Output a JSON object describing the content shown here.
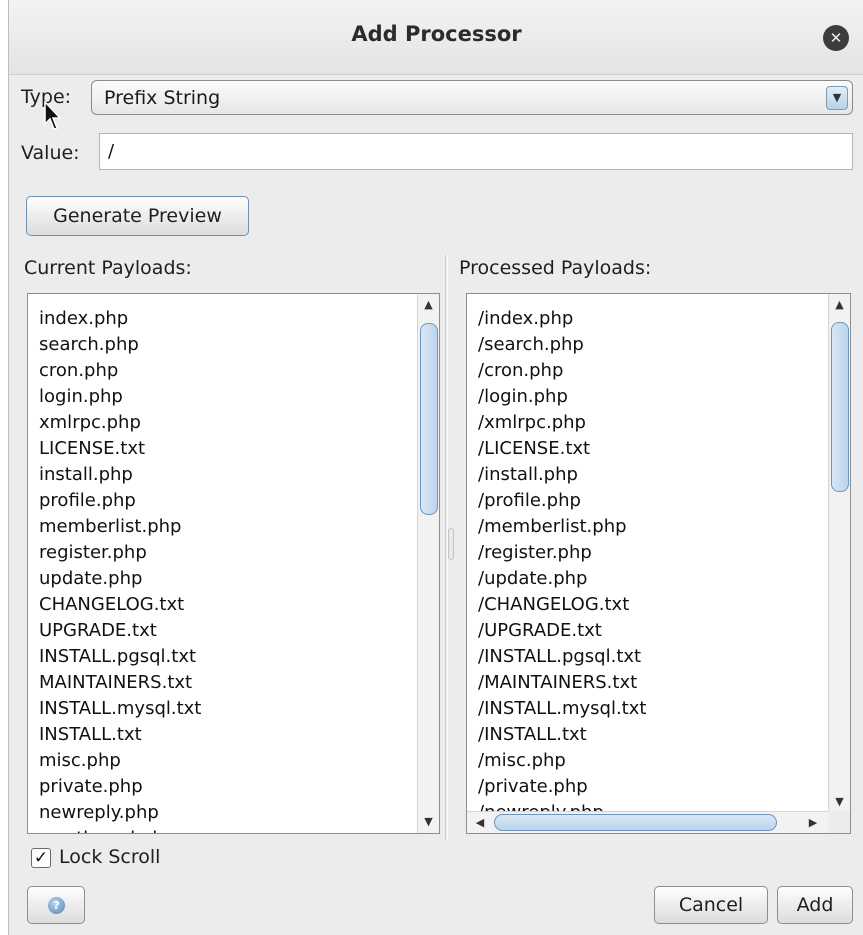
{
  "dialog": {
    "title": "Add Processor",
    "close_icon": "close-icon"
  },
  "form": {
    "type_label": "Type:",
    "type_value": "Prefix String",
    "value_label": "Value:",
    "value_text": "/"
  },
  "buttons": {
    "generate_preview": "Generate Preview",
    "cancel": "Cancel",
    "add": "Add",
    "help_icon": "help-icon"
  },
  "current_payloads": {
    "label": "Current Payloads:",
    "items": [
      "index.php",
      "search.php",
      "cron.php",
      "login.php",
      "xmlrpc.php",
      "LICENSE.txt",
      "install.php",
      "profile.php",
      "memberlist.php",
      "register.php",
      "update.php",
      "CHANGELOG.txt",
      "UPGRADE.txt",
      "INSTALL.pgsql.txt",
      "MAINTAINERS.txt",
      "INSTALL.mysql.txt",
      "INSTALL.txt",
      "misc.php",
      "private.php",
      "newreply.php",
      "newthread.php"
    ]
  },
  "processed_payloads": {
    "label": "Processed Payloads:",
    "items": [
      "/index.php",
      "/search.php",
      "/cron.php",
      "/login.php",
      "/xmlrpc.php",
      "/LICENSE.txt",
      "/install.php",
      "/profile.php",
      "/memberlist.php",
      "/register.php",
      "/update.php",
      "/CHANGELOG.txt",
      "/UPGRADE.txt",
      "/INSTALL.pgsql.txt",
      "/MAINTAINERS.txt",
      "/INSTALL.mysql.txt",
      "/INSTALL.txt",
      "/misc.php",
      "/private.php",
      "/newreply.php"
    ]
  },
  "lock_scroll": {
    "label": "Lock Scroll",
    "checked": true
  },
  "colors": {
    "accent": "#6f96bf",
    "dialog_bg": "#ececec"
  }
}
